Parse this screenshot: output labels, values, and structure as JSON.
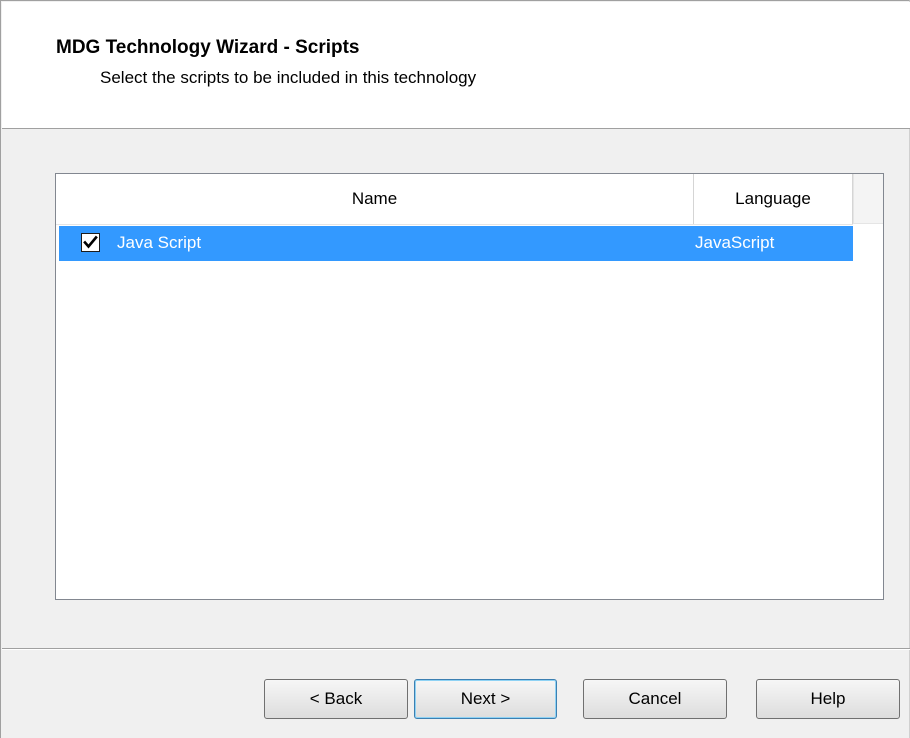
{
  "header": {
    "title": "MDG Technology Wizard - Scripts",
    "subtitle": "Select the scripts to be included in this technology"
  },
  "list": {
    "columns": [
      "Name",
      "Language"
    ],
    "rows": [
      {
        "checked": true,
        "name": "Java Script",
        "language": "JavaScript",
        "selected": true
      }
    ]
  },
  "buttons": {
    "back": "< Back",
    "next": "Next >",
    "cancel": "Cancel",
    "help": "Help"
  },
  "colors": {
    "selection": "#3399ff"
  }
}
